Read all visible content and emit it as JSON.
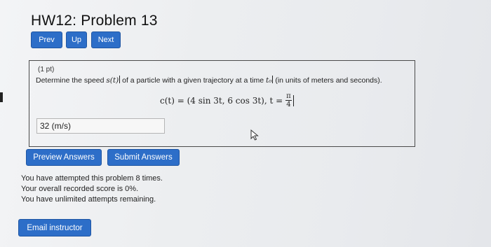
{
  "page": {
    "title": "HW12: Problem 13"
  },
  "nav": {
    "prev": "Prev",
    "up": "Up",
    "next": "Next"
  },
  "problem": {
    "points": "(1 pt)",
    "statement_pre": "Determine the speed ",
    "speed_symbol": "s(t)",
    "statement_mid": " of a particle with a given trajectory at a time ",
    "time_symbol": "t₀",
    "statement_post": " (in units of meters and seconds).",
    "equation": "c(t) = (4 sin 3t, 6 cos 3t),  t = ",
    "t_numerator": "π",
    "t_denominator": "4"
  },
  "answer": {
    "value": "32 (m/s)"
  },
  "actions": {
    "preview": "Preview Answers",
    "submit": "Submit Answers"
  },
  "status": {
    "attempts": "You have attempted this problem 8 times.",
    "score": "Your overall recorded score is 0%.",
    "remaining": "You have unlimited attempts remaining."
  },
  "footer": {
    "email": "Email instructor"
  },
  "colors": {
    "button_blue": "#2d6ec8",
    "box_border": "#4a4a4a"
  }
}
